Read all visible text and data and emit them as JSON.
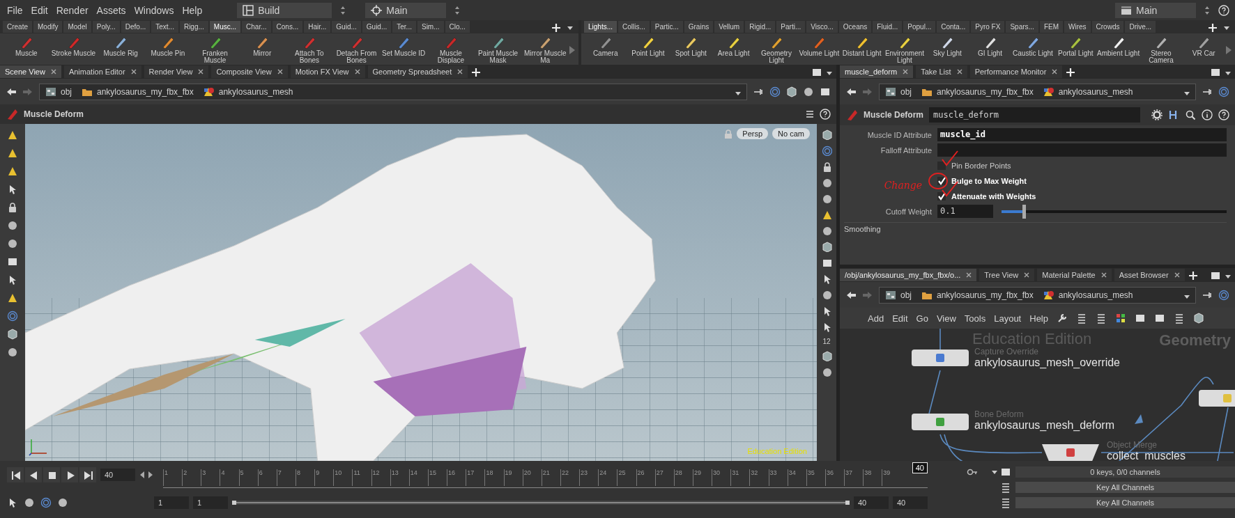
{
  "menu_bar": {
    "items": [
      "File",
      "Edit",
      "Render",
      "Assets",
      "Windows",
      "Help"
    ],
    "desktop": "Build",
    "context": "Main",
    "right_context": "Main"
  },
  "shelf_left": {
    "tabs": [
      {
        "label": "Create",
        "selected": false
      },
      {
        "label": "Modify",
        "selected": false
      },
      {
        "label": "Model",
        "selected": false
      },
      {
        "label": "Poly...",
        "selected": false
      },
      {
        "label": "Defo...",
        "selected": false
      },
      {
        "label": "Text...",
        "selected": false
      },
      {
        "label": "Rigg...",
        "selected": false
      },
      {
        "label": "Musc...",
        "selected": true
      },
      {
        "label": "Char...",
        "selected": false
      },
      {
        "label": "Cons...",
        "selected": false
      },
      {
        "label": "Hair...",
        "selected": false
      },
      {
        "label": "Guid...",
        "selected": false
      },
      {
        "label": "Guid...",
        "selected": false
      },
      {
        "label": "Ter...",
        "selected": false
      },
      {
        "label": "Sim...",
        "selected": false
      },
      {
        "label": "Clo...",
        "selected": false
      }
    ],
    "tools": [
      {
        "label": "Muscle",
        "color": "#d03030"
      },
      {
        "label": "Stroke Muscle",
        "color": "#d02828"
      },
      {
        "label": "Muscle Rig",
        "color": "#8ab0d8"
      },
      {
        "label": "Muscle Pin",
        "color": "#e08a30"
      },
      {
        "label": "Franken Muscle",
        "color": "#58b040"
      },
      {
        "label": "Mirror",
        "color": "#d89050"
      },
      {
        "label": "Attach To Bones",
        "color": "#d03030"
      },
      {
        "label": "Detach From Bones",
        "color": "#d03030"
      },
      {
        "label": "Set Muscle ID",
        "color": "#5a8ad0"
      },
      {
        "label": "Muscle Displace",
        "color": "#c82828"
      },
      {
        "label": "Paint Muscle Mask",
        "color": "#70a8a0"
      },
      {
        "label": "Mirror Muscle Ma",
        "color": "#c8a070"
      }
    ]
  },
  "shelf_right": {
    "tabs": [
      {
        "label": "Lights...",
        "selected": true
      },
      {
        "label": "Collis...",
        "selected": false
      },
      {
        "label": "Partic...",
        "selected": false
      },
      {
        "label": "Grains",
        "selected": false
      },
      {
        "label": "Vellum",
        "selected": false
      },
      {
        "label": "Rigid...",
        "selected": false
      },
      {
        "label": "Parti...",
        "selected": false
      },
      {
        "label": "Visco...",
        "selected": false
      },
      {
        "label": "Oceans",
        "selected": false
      },
      {
        "label": "Fluid...",
        "selected": false
      },
      {
        "label": "Popul...",
        "selected": false
      },
      {
        "label": "Conta...",
        "selected": false
      },
      {
        "label": "Pyro FX",
        "selected": false
      },
      {
        "label": "Spars...",
        "selected": false
      },
      {
        "label": "FEM",
        "selected": false
      },
      {
        "label": "Wires",
        "selected": false
      },
      {
        "label": "Crowds",
        "selected": false
      },
      {
        "label": "Drive...",
        "selected": false
      }
    ],
    "tools": [
      {
        "label": "Camera",
        "color": "#909090"
      },
      {
        "label": "Point Light",
        "color": "#f0d040"
      },
      {
        "label": "Spot Light",
        "color": "#e8c860"
      },
      {
        "label": "Area Light",
        "color": "#e8d040"
      },
      {
        "label": "Geometry Light",
        "color": "#e0a030"
      },
      {
        "label": "Volume Light",
        "color": "#e06020"
      },
      {
        "label": "Distant Light",
        "color": "#f0c030"
      },
      {
        "label": "Environment Light",
        "color": "#e8d040"
      },
      {
        "label": "Sky Light",
        "color": "#d0d8e8"
      },
      {
        "label": "GI Light",
        "color": "#e0e0e0"
      },
      {
        "label": "Caustic Light",
        "color": "#80a8e0"
      },
      {
        "label": "Portal Light",
        "color": "#a8c040"
      },
      {
        "label": "Ambient Light",
        "color": "#f0f0f0"
      },
      {
        "label": "Stereo Camera",
        "color": "#b0b0b0"
      },
      {
        "label": "VR Car",
        "color": "#a0a0a0"
      }
    ]
  },
  "scene_viewer": {
    "tabs": [
      {
        "label": "Scene View",
        "selected": true
      },
      {
        "label": "Animation Editor",
        "selected": false
      },
      {
        "label": "Render View",
        "selected": false
      },
      {
        "label": "Composite View",
        "selected": false
      },
      {
        "label": "Motion FX View",
        "selected": false
      },
      {
        "label": "Geometry Spreadsheet",
        "selected": false
      }
    ],
    "path": [
      "obj",
      "ankylosaurus_my_fbx_fbx",
      "ankylosaurus_mesh"
    ],
    "title": "Muscle Deform",
    "camera_buttons": [
      "Persp",
      "No cam"
    ],
    "watermark": "Education Edition",
    "toolbar_label": "12"
  },
  "parameters": {
    "tabs": [
      {
        "label": "muscle_deform",
        "selected": true
      },
      {
        "label": "Take List",
        "selected": false
      },
      {
        "label": "Performance Monitor",
        "selected": false
      }
    ],
    "path": [
      "obj",
      "ankylosaurus_my_fbx_fbx",
      "ankylosaurus_mesh"
    ],
    "node_type": "Muscle Deform",
    "node_name": "muscle_deform",
    "fields": [
      {
        "kind": "text",
        "label": "Muscle ID Attribute",
        "value": "muscle_id"
      },
      {
        "kind": "text",
        "label": "Falloff Attribute"
      },
      {
        "kind": "checkbox",
        "label": "Pin Border Points",
        "checked": false,
        "annotated": true,
        "circled": false
      },
      {
        "kind": "checkbox",
        "label": "Bulge to Max Weight",
        "checked": true,
        "annotated": false,
        "circled": true
      },
      {
        "kind": "checkbox",
        "label": "Attenuate with Weights",
        "checked": true,
        "annotated": true,
        "circled": false
      },
      {
        "kind": "slider",
        "label": "Cutoff Weight",
        "value": "0.1",
        "level": 0.1
      }
    ],
    "section": "Smoothing",
    "annotation": "Change"
  },
  "network": {
    "tabs": [
      {
        "label": "/obj/ankylosaurus_my_fbx_fbx/o...",
        "selected": true
      },
      {
        "label": "Tree View",
        "selected": false
      },
      {
        "label": "Material Palette",
        "selected": false
      },
      {
        "label": "Asset Browser",
        "selected": false
      }
    ],
    "path": [
      "obj",
      "ankylosaurus_my_fbx_fbx",
      "ankylosaurus_mesh"
    ],
    "menu": [
      "Add",
      "Edit",
      "Go",
      "View",
      "Tools",
      "Layout",
      "Help"
    ],
    "watermark": "Education Edition",
    "context_label": "Geometry",
    "nodes": [
      {
        "kind": "rect",
        "type": "Capture Override",
        "name": "ankylosaurus_mesh_override"
      },
      {
        "kind": "rect",
        "type": "Bone Deform",
        "name": "ankylosaurus_mesh_deform"
      },
      {
        "kind": "trapezoid",
        "type": "Object Merge",
        "name": "collect_muscles"
      },
      {
        "kind": "rect"
      }
    ]
  },
  "timeline": {
    "frame": "40",
    "ticks": [
      "1",
      "2",
      "3",
      "4",
      "5",
      "6",
      "7",
      "8",
      "9",
      "10",
      "11",
      "12",
      "13",
      "14",
      "15",
      "16",
      "17",
      "18",
      "19",
      "20",
      "21",
      "22",
      "23",
      "24",
      "25",
      "26",
      "27",
      "28",
      "29",
      "30",
      "31",
      "32",
      "33",
      "34",
      "35",
      "36",
      "37",
      "38",
      "39"
    ],
    "current_marker": "40",
    "range_start": [
      "1",
      "1"
    ],
    "level": 1,
    "range_end": [
      "40",
      "40"
    ],
    "keys": "0 keys, 0/0 channels",
    "buttons": [
      "Key All Channels",
      "Key All Channels"
    ]
  }
}
